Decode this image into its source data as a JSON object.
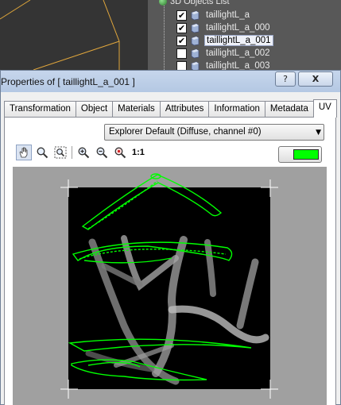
{
  "scene_tree": {
    "root_label": "3D Objects List",
    "items": [
      {
        "label": "taillightL_a",
        "checked": true,
        "selected": false
      },
      {
        "label": "taillightL_a_000",
        "checked": true,
        "selected": false
      },
      {
        "label": "taillightL_a_001",
        "checked": true,
        "selected": true
      },
      {
        "label": "taillightL_a_002",
        "checked": false,
        "selected": false
      },
      {
        "label": "taillightL_a_003",
        "checked": false,
        "selected": false
      }
    ]
  },
  "window": {
    "title": "Properties of  [ taillightL_a_001 ]",
    "help_label": "?",
    "close_label": "X"
  },
  "tabs": [
    {
      "label": "Transformation",
      "active": false
    },
    {
      "label": "Object",
      "active": false
    },
    {
      "label": "Materials",
      "active": false
    },
    {
      "label": "Attributes",
      "active": false
    },
    {
      "label": "Information",
      "active": false
    },
    {
      "label": "Metadata",
      "active": false
    },
    {
      "label": "UV",
      "active": true
    }
  ],
  "uv_panel": {
    "texture_select": "Explorer Default (Diffuse, channel #0)",
    "dropdown_arrow": "▼",
    "ratio_label": "1:1",
    "tools": [
      "pan-icon",
      "zoom-icon",
      "zoom-extents-icon",
      "zoom-in-icon",
      "zoom-out-icon",
      "zoom-reset-icon"
    ],
    "wire_color": "#00ff00"
  },
  "icons": {
    "check": "✔"
  }
}
